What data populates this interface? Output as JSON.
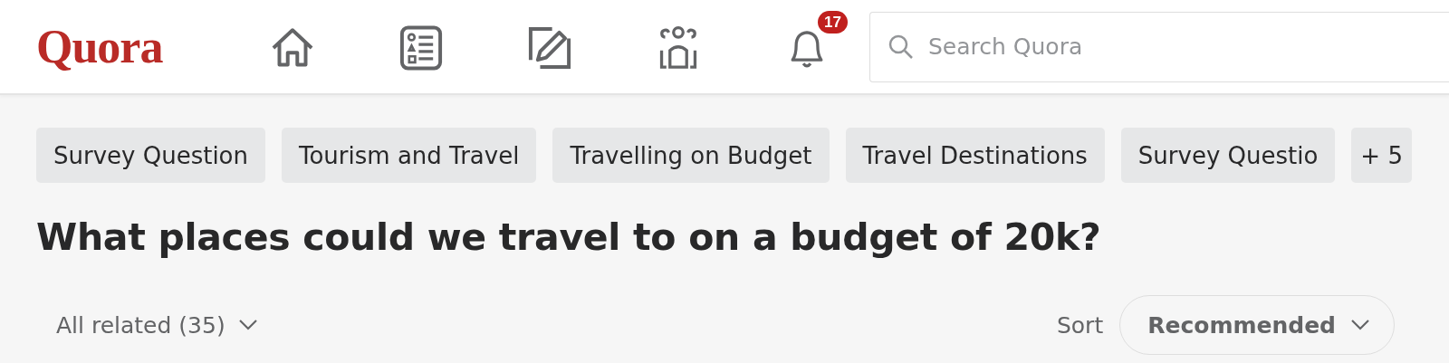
{
  "header": {
    "logo": "Quora",
    "nav": [
      {
        "kind": "home",
        "selected": false
      },
      {
        "kind": "answer",
        "selected": false
      },
      {
        "kind": "write",
        "selected": false
      },
      {
        "kind": "spaces",
        "selected": false
      },
      {
        "kind": "notifications",
        "selected": false,
        "badge": "17"
      }
    ],
    "search": {
      "placeholder": "Search Quora"
    }
  },
  "topics": [
    "Survey Question",
    "Tourism and Travel",
    "Travelling on Budget",
    "Travel Destinations",
    "Survey Questio"
  ],
  "more_topics": "+ 5",
  "question": "What places could we travel to on a budget of 20k?",
  "filter": {
    "label": "All related (35)"
  },
  "sort": {
    "label": "Sort",
    "value": "Recommended"
  }
}
